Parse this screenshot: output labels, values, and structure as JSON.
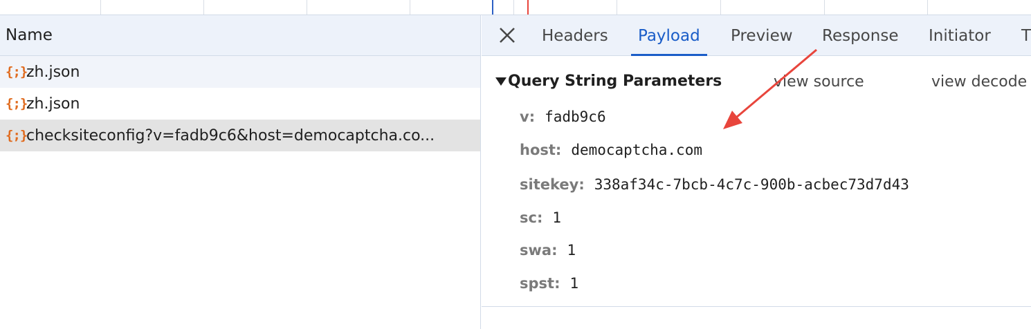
{
  "list": {
    "header": "Name",
    "requests": [
      {
        "icon": "{;}",
        "name": "zh.json"
      },
      {
        "icon": "{;}",
        "name": "zh.json"
      },
      {
        "icon": "{;}",
        "name": "checksiteconfig?v=fadb9c6&host=democaptcha.co..."
      }
    ]
  },
  "details": {
    "tabs": [
      {
        "label": "Headers"
      },
      {
        "label": "Payload"
      },
      {
        "label": "Preview"
      },
      {
        "label": "Response"
      },
      {
        "label": "Initiator"
      },
      {
        "label": "T"
      }
    ],
    "active_tab": "Payload",
    "section": {
      "title": "Query String Parameters",
      "view_source": "view source",
      "view_decoded": "view decode"
    },
    "params": [
      {
        "key": "v:",
        "value": "fadb9c6"
      },
      {
        "key": "host:",
        "value": "democaptcha.com"
      },
      {
        "key": "sitekey:",
        "value": "338af34c-7bcb-4c7c-900b-acbec73d7d43"
      },
      {
        "key": "sc:",
        "value": "1"
      },
      {
        "key": "swa:",
        "value": "1"
      },
      {
        "key": "spst:",
        "value": "1"
      }
    ]
  },
  "colors": {
    "accent": "#1a5dc8",
    "icon": "#e06b1f",
    "annotation": "#e8453c"
  }
}
